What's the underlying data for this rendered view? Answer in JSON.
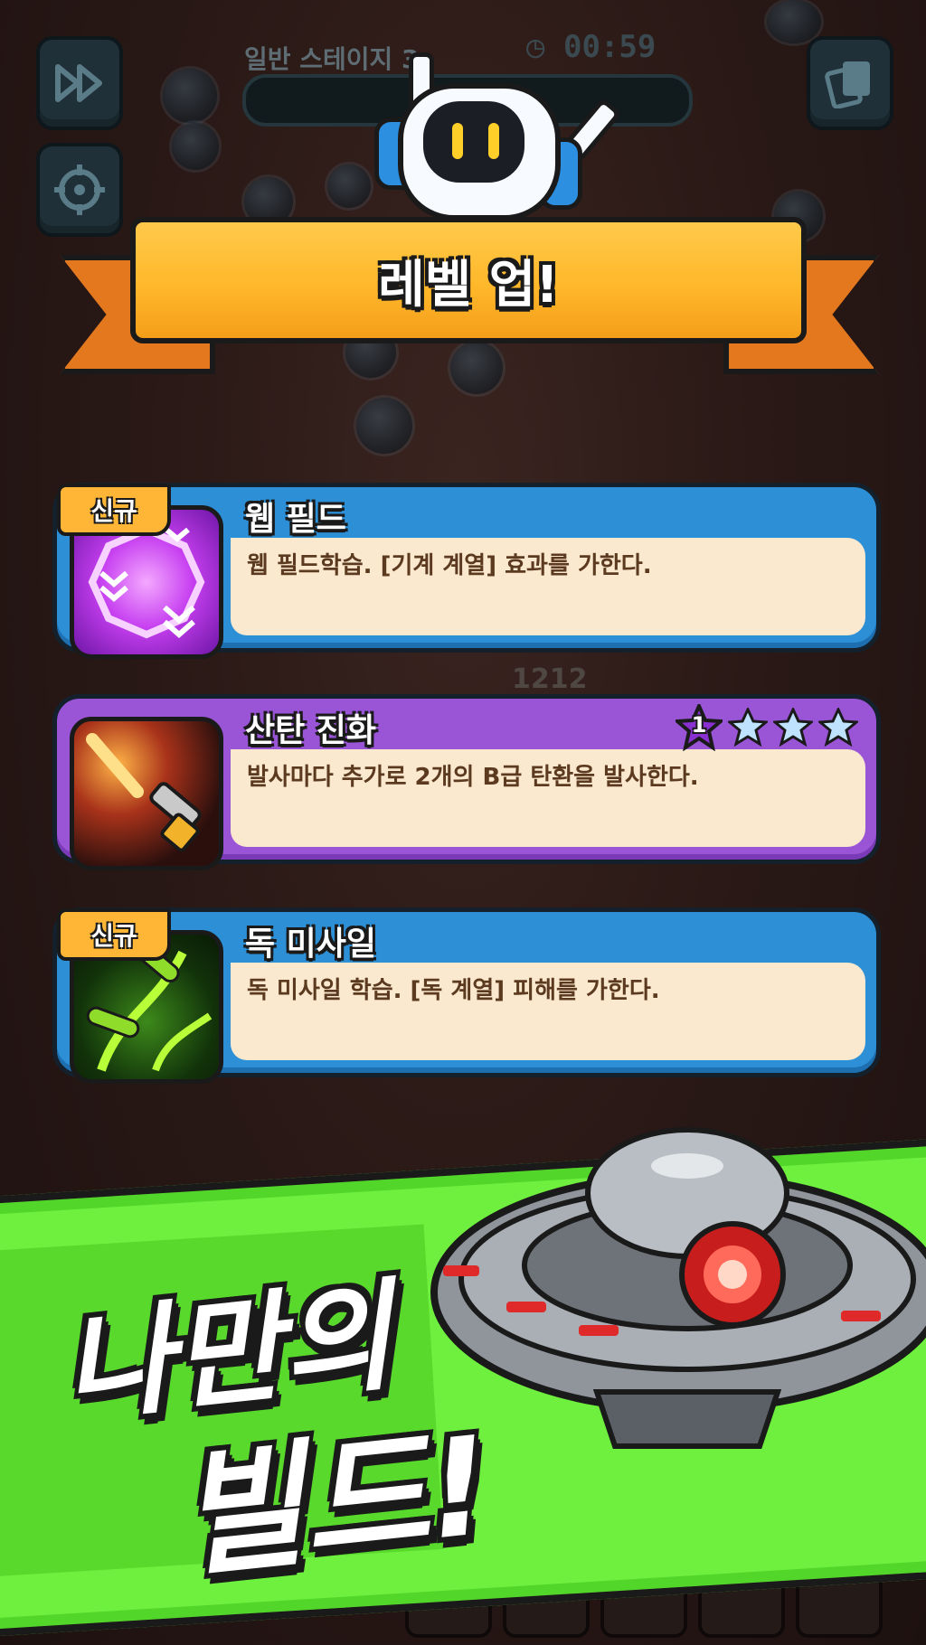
{
  "hud": {
    "stage_label": "일반 스테이지 3",
    "timer": "00:59",
    "left_buttons": [
      "fast-forward-icon",
      "target-icon"
    ],
    "right_button": "cards-icon"
  },
  "banner": {
    "title": "레벨 업!"
  },
  "cards": [
    {
      "title": "웹 필드",
      "badge": "신규",
      "description": "웹 필드학습. [기계 계열] 효과를 가한다.",
      "theme_color": "#2d8fd6",
      "icon": "web-field-icon"
    },
    {
      "title": "산탄 진화",
      "level": "1",
      "stars_total": 4,
      "stars_filled": 1,
      "description": "발사마다 추가로 2개의 B급 탄환을 발사한다.",
      "theme_color": "#9a54d6",
      "icon": "shotgun-icon"
    },
    {
      "title": "독 미사일",
      "badge": "신규",
      "description": "독 미사일 학습. [독 계열] 피해를 가한다.",
      "theme_color": "#2d8fd6",
      "icon": "poison-missile-icon"
    }
  ],
  "floating_number": "1212",
  "promo": {
    "line1": "나만의",
    "line2": "빌드!"
  }
}
